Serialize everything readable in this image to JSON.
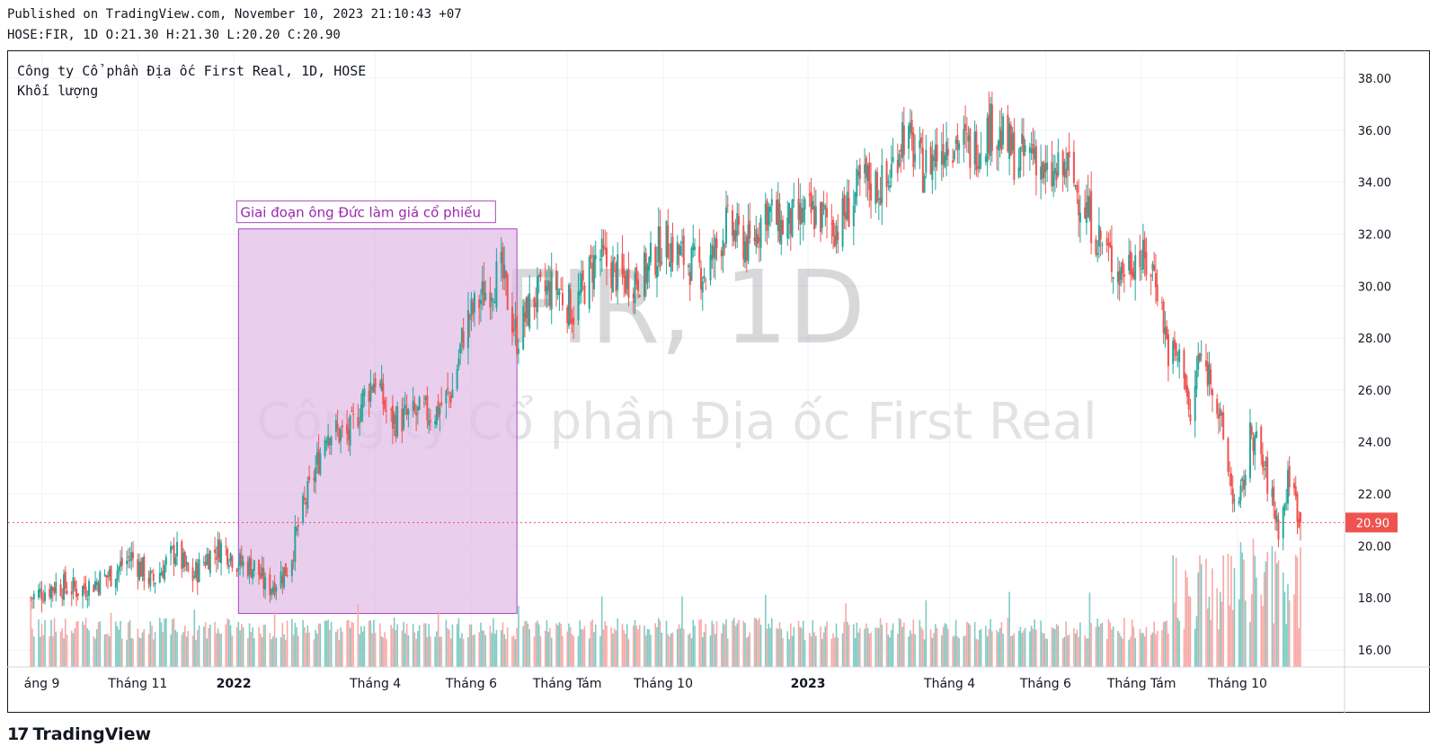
{
  "header": {
    "published": "Published on TradingView.com, November 10, 2023 21:10:43 +07",
    "ohlc": "HOSE:FIR, 1D O:21.30 H:21.30 L:20.20 C:20.90"
  },
  "legend": {
    "title": "Công ty Cổ phần Địa ốc First Real, 1D, HOSE",
    "volume": "Khối lượng"
  },
  "watermark": {
    "symbol": "FIR, 1D",
    "name": "Công ty Cổ phần Địa ốc First Real"
  },
  "annotation": {
    "text": "Giai đoạn ông Đức làm giá cổ phiếu",
    "start_date": "2022-01-04",
    "end_date": "2022-06-30",
    "price_top": 32.2,
    "price_bottom": 17.4
  },
  "branding": {
    "logo_mark": "17",
    "logo_text": "TradingView"
  },
  "colors": {
    "up": "#26a69a",
    "down": "#ef5350",
    "up_volume": "#80cbc4",
    "down_volume": "#f7a9a7",
    "annotation_fill": "#e1bee7",
    "annotation_border": "#ab47bc",
    "annotation_text": "#9c27b0",
    "last_price": "#ef5350"
  },
  "chart_data": {
    "type": "candlestick",
    "symbol": "HOSE:FIR",
    "interval": "1D",
    "y_axis": {
      "min": 15.4,
      "max": 38.6,
      "ticks": [
        "16.00",
        "18.00",
        "20.00",
        "22.00",
        "24.00",
        "26.00",
        "28.00",
        "30.00",
        "32.00",
        "34.00",
        "36.00",
        "38.00"
      ],
      "position": "right"
    },
    "x_axis": {
      "ticks": [
        {
          "label": "áng 9",
          "date": "2021-09-01"
        },
        {
          "label": "Tháng 11",
          "date": "2021-11-01"
        },
        {
          "label": "2022",
          "date": "2022-01-01",
          "bold": true
        },
        {
          "label": "Tháng 4",
          "date": "2022-04-01"
        },
        {
          "label": "Tháng 6",
          "date": "2022-06-01"
        },
        {
          "label": "Tháng Tám",
          "date": "2022-08-01"
        },
        {
          "label": "Tháng 10",
          "date": "2022-10-01"
        },
        {
          "label": "2023",
          "date": "2023-01-01",
          "bold": true
        },
        {
          "label": "Tháng 4",
          "date": "2023-04-01"
        },
        {
          "label": "Tháng 6",
          "date": "2023-06-01"
        },
        {
          "label": "Tháng Tám",
          "date": "2023-08-01"
        },
        {
          "label": "Tháng 10",
          "date": "2023-10-01"
        }
      ]
    },
    "close_path": [
      {
        "date": "2021-08-25",
        "close": 18.0
      },
      {
        "date": "2021-09-10",
        "close": 18.5
      },
      {
        "date": "2021-09-25",
        "close": 18.3
      },
      {
        "date": "2021-10-15",
        "close": 18.9
      },
      {
        "date": "2021-10-28",
        "close": 19.6
      },
      {
        "date": "2021-11-10",
        "close": 18.6
      },
      {
        "date": "2021-11-25",
        "close": 19.8
      },
      {
        "date": "2021-12-05",
        "close": 18.7
      },
      {
        "date": "2021-12-15",
        "close": 19.6
      },
      {
        "date": "2021-12-25",
        "close": 20.0
      },
      {
        "date": "2022-01-05",
        "close": 19.3
      },
      {
        "date": "2022-01-15",
        "close": 19.2
      },
      {
        "date": "2022-01-22",
        "close": 18.3
      },
      {
        "date": "2022-02-05",
        "close": 19.2
      },
      {
        "date": "2022-02-12",
        "close": 21.0
      },
      {
        "date": "2022-02-20",
        "close": 22.5
      },
      {
        "date": "2022-03-01",
        "close": 24.5
      },
      {
        "date": "2022-03-15",
        "close": 24.2
      },
      {
        "date": "2022-03-25",
        "close": 25.8
      },
      {
        "date": "2022-04-01",
        "close": 26.5
      },
      {
        "date": "2022-04-10",
        "close": 24.8
      },
      {
        "date": "2022-04-25",
        "close": 25.0
      },
      {
        "date": "2022-05-10",
        "close": 25.2
      },
      {
        "date": "2022-05-20",
        "close": 26.0
      },
      {
        "date": "2022-05-28",
        "close": 28.5
      },
      {
        "date": "2022-06-10",
        "close": 29.8
      },
      {
        "date": "2022-06-20",
        "close": 30.5
      },
      {
        "date": "2022-06-30",
        "close": 28.0
      },
      {
        "date": "2022-07-10",
        "close": 29.5
      },
      {
        "date": "2022-07-25",
        "close": 30.0
      },
      {
        "date": "2022-08-05",
        "close": 29.0
      },
      {
        "date": "2022-08-20",
        "close": 31.2
      },
      {
        "date": "2022-09-05",
        "close": 30.2
      },
      {
        "date": "2022-09-20",
        "close": 30.5
      },
      {
        "date": "2022-10-01",
        "close": 31.8
      },
      {
        "date": "2022-10-15",
        "close": 31.0
      },
      {
        "date": "2022-10-28",
        "close": 30.5
      },
      {
        "date": "2022-11-10",
        "close": 32.3
      },
      {
        "date": "2022-11-25",
        "close": 31.5
      },
      {
        "date": "2022-12-05",
        "close": 33.0
      },
      {
        "date": "2022-12-15",
        "close": 32.3
      },
      {
        "date": "2023-01-05",
        "close": 32.8
      },
      {
        "date": "2023-01-20",
        "close": 32.3
      },
      {
        "date": "2023-02-05",
        "close": 34.0
      },
      {
        "date": "2023-02-20",
        "close": 33.8
      },
      {
        "date": "2023-03-02",
        "close": 36.0
      },
      {
        "date": "2023-03-15",
        "close": 34.5
      },
      {
        "date": "2023-04-01",
        "close": 35.8
      },
      {
        "date": "2023-04-15",
        "close": 35.2
      },
      {
        "date": "2023-04-28",
        "close": 36.2
      },
      {
        "date": "2023-05-15",
        "close": 34.8
      },
      {
        "date": "2023-05-25",
        "close": 35.3
      },
      {
        "date": "2023-06-01",
        "close": 34.0
      },
      {
        "date": "2023-06-15",
        "close": 34.5
      },
      {
        "date": "2023-06-25",
        "close": 33.2
      },
      {
        "date": "2023-07-05",
        "close": 31.8
      },
      {
        "date": "2023-07-18",
        "close": 30.5
      },
      {
        "date": "2023-07-28",
        "close": 31.2
      },
      {
        "date": "2023-08-10",
        "close": 30.5
      },
      {
        "date": "2023-08-18",
        "close": 27.5
      },
      {
        "date": "2023-08-28",
        "close": 27.0
      },
      {
        "date": "2023-09-01",
        "close": 24.5
      },
      {
        "date": "2023-09-06",
        "close": 27.2
      },
      {
        "date": "2023-09-15",
        "close": 26.5
      },
      {
        "date": "2023-09-25",
        "close": 23.0
      },
      {
        "date": "2023-10-01",
        "close": 21.0
      },
      {
        "date": "2023-10-10",
        "close": 24.5
      },
      {
        "date": "2023-10-20",
        "close": 22.5
      },
      {
        "date": "2023-10-28",
        "close": 20.5
      },
      {
        "date": "2023-11-03",
        "close": 22.8
      },
      {
        "date": "2023-11-10",
        "close": 20.9
      }
    ],
    "last_bar": {
      "date": "2023-11-10",
      "open": 21.3,
      "high": 21.3,
      "low": 20.2,
      "close": 20.9
    },
    "last_price_label": "20.90",
    "volume_pane": "bottom overlay",
    "grid": true
  }
}
